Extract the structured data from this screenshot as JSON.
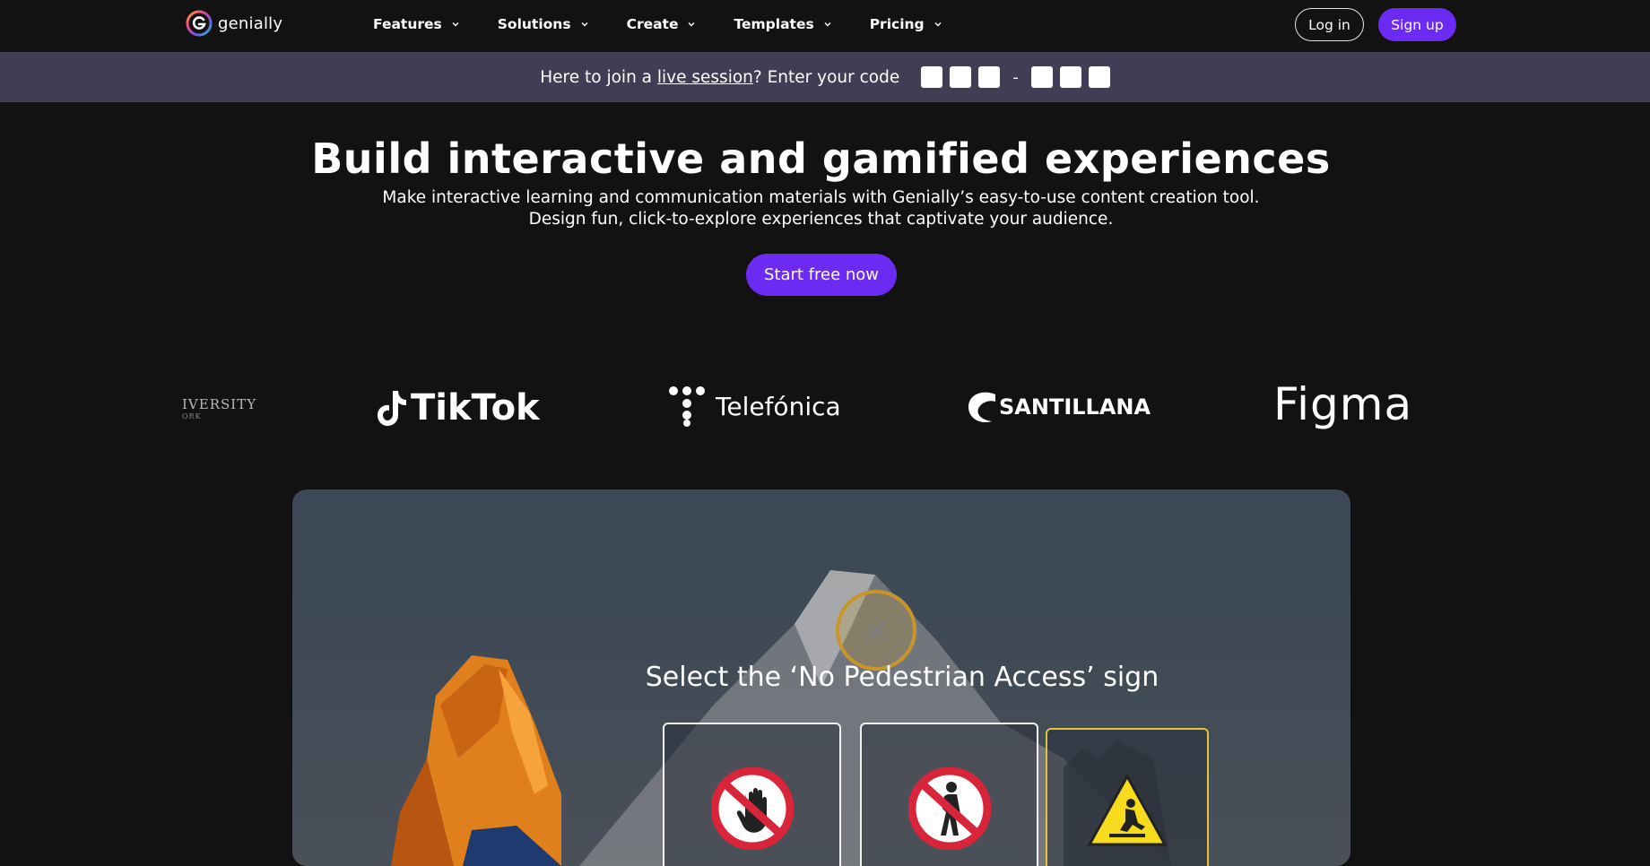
{
  "brand": {
    "name": "genially"
  },
  "nav": {
    "items": [
      {
        "label": "Features"
      },
      {
        "label": "Solutions"
      },
      {
        "label": "Create"
      },
      {
        "label": "Templates"
      },
      {
        "label": "Pricing"
      }
    ],
    "login_label": "Log in",
    "signup_label": "Sign up"
  },
  "join_bar": {
    "prefix": "Here to join a ",
    "link_text": "live session",
    "suffix": "? Enter your code",
    "code_dash": "-"
  },
  "hero": {
    "title": "Build interactive and gamified experiences",
    "subtitle": "Make interactive learning and communication materials with Genially’s easy-to-use content creation tool. Design fun, click-to-explore experiences that captivate your audience.",
    "cta_label": "Start free now"
  },
  "logos": {
    "university_main": "IVERSITY",
    "university_small": "ORK",
    "tiktok": "TikTok",
    "telefonica": "Telefónica",
    "santillana": "SANTILLANA",
    "figma": "Figma"
  },
  "demo": {
    "question": "Select the ‘No Pedestrian Access’ sign"
  },
  "colors": {
    "accent": "#6c2bf2",
    "join_bar_bg": "#403e55",
    "page_bg": "#121212",
    "highlight": "#e6c23c"
  }
}
